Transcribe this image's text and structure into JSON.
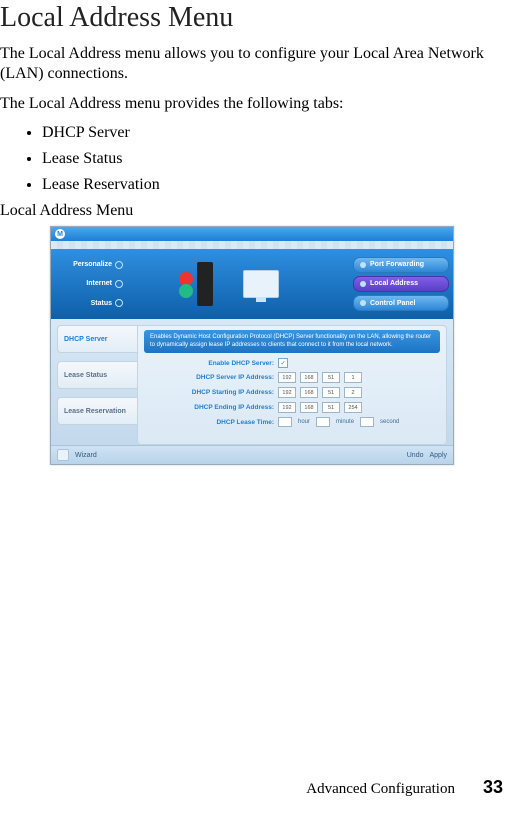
{
  "title": "Local Address Menu",
  "intro": "The Local Address menu allows you to configure your Local Area Network (LAN) connections.",
  "tabline": "The Local Address menu provides the following tabs:",
  "bullets": [
    "DHCP Server",
    "Lease Status",
    "Lease Reservation"
  ],
  "caption": "Local Address Menu",
  "shot": {
    "logo_letter": "M",
    "nav_left": {
      "personalize": "Personalize",
      "internet": "Internet",
      "status": "Status"
    },
    "nav_right": {
      "port_forwarding": "Port Forwarding",
      "local_address": "Local Address",
      "control_panel": "Control Panel"
    },
    "side_tabs": {
      "dhcp": "DHCP Server",
      "lease_status": "Lease Status",
      "lease_reservation": "Lease Reservation"
    },
    "panel": {
      "desc": "Enables Dynamic Host Configuration Protocol (DHCP) Server functionality on the LAN, allowing the router to dynamically assign lease IP addresses to clients that connect to it from the local network.",
      "enable_label": "Enable DHCP Server:",
      "enable_checked": "✓",
      "server_ip_label": "DHCP Server IP Address:",
      "server_ip": [
        "192",
        "168",
        "51",
        "1"
      ],
      "start_ip_label": "DHCP Starting IP Address:",
      "start_ip": [
        "192",
        "168",
        "51",
        "2"
      ],
      "end_ip_label": "DHCP Ending IP Address:",
      "end_ip": [
        "192",
        "168",
        "51",
        "254"
      ],
      "lease_time_label": "DHCP Lease Time:",
      "units": {
        "hour": "hour",
        "minute": "minute",
        "second": "second"
      }
    },
    "footer": {
      "wizard": "Wizard",
      "undo": "Undo",
      "apply": "Apply"
    }
  },
  "footer": {
    "section": "Advanced Configuration",
    "page": "33"
  }
}
